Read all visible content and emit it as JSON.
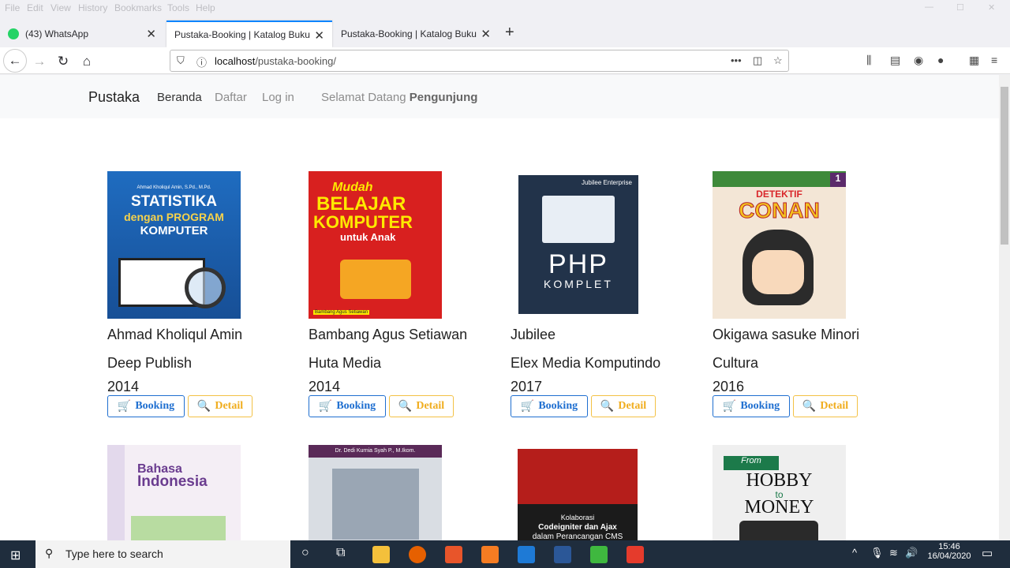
{
  "menubar": [
    "File",
    "Edit",
    "View",
    "History",
    "Bookmarks",
    "Tools",
    "Help"
  ],
  "tabs": [
    {
      "label": "(43) WhatsApp",
      "active": false
    },
    {
      "label": "Pustaka-Booking | Katalog Buku",
      "active": true
    },
    {
      "label": "Pustaka-Booking | Katalog Buku",
      "active": false
    }
  ],
  "url": {
    "host": "localhost",
    "path": "/pustaka-booking/"
  },
  "site": {
    "brand": "Pustaka",
    "nav": [
      "Beranda",
      "Daftar",
      "Log in"
    ],
    "welcome_prefix": "Selamat Datang",
    "welcome_user": "Pengunjung"
  },
  "buttons": {
    "booking": "Booking",
    "detail": "Detail"
  },
  "books": [
    {
      "author": "Ahmad Kholiqul Amin",
      "publisher": "Deep Publish",
      "year": "2014",
      "cover_text": [
        "Ahmad Kholiqul Amin, S.Pd., M.Pd.",
        "STATISTIKA",
        "dengan PROGRAM",
        "KOMPUTER"
      ],
      "cover_color": "#1d5fae"
    },
    {
      "author": "Bambang Agus Setiawan",
      "publisher": "Huta Media",
      "year": "2014",
      "cover_text": [
        "Mudah",
        "BELAJAR",
        "KOMPUTER",
        "untuk Anak",
        "Bambang Agus Setiawan"
      ],
      "cover_color": "#d8201f"
    },
    {
      "author": "Jubilee",
      "publisher": "Elex Media Komputindo",
      "year": "2017",
      "cover_text": [
        "Jubilee Enterprise",
        "PHP",
        "KOMPLET"
      ],
      "cover_color": "#22334a"
    },
    {
      "author": "Okigawa sasuke Minori",
      "publisher": "Cultura",
      "year": "2016",
      "cover_text": [
        "DETEKTIF",
        "CONAN",
        "1"
      ],
      "cover_color": "#f3e6d6"
    },
    {
      "cover_text": [
        "Bahasa",
        "Indonesia"
      ],
      "cover_color": "#f4eef5"
    },
    {
      "cover_text": [
        "Dr. Dedi Kurnia Syah P., M.Ikom."
      ],
      "cover_color": "#d9dde3"
    },
    {
      "cover_text": [
        "Kolaborasi",
        "Codeigniter dan Ajax",
        "dalam Perancangan CMS"
      ],
      "cover_color": "#1b1b1b"
    },
    {
      "cover_text": [
        "From",
        "HOBBY",
        "to",
        "MONEY"
      ],
      "cover_color": "#efefef"
    }
  ],
  "taskbar": {
    "search_placeholder": "Type here to search",
    "time": "15:46",
    "date": "16/04/2020"
  }
}
